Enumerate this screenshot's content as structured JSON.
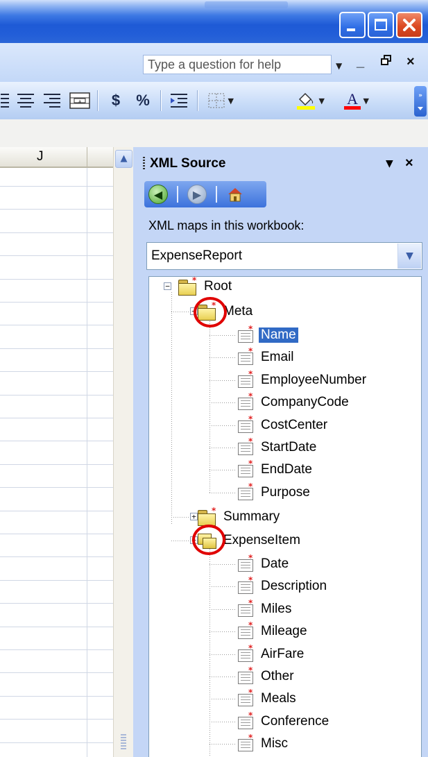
{
  "window": {
    "help_placeholder": "Type a question for help",
    "doc_controls": [
      "_",
      "❐",
      "×"
    ]
  },
  "toolbar": {
    "currency": "$",
    "percent": "%",
    "font_color_letter": "A"
  },
  "sheet": {
    "column_label": "J"
  },
  "pane": {
    "title": "XML Source",
    "maps_label": "XML maps in this workbook:",
    "selected_map": "ExpenseReport",
    "tree": {
      "root": "Root",
      "meta": "Meta",
      "meta_items": [
        "Name",
        "Email",
        "EmployeeNumber",
        "CompanyCode",
        "CostCenter",
        "StartDate",
        "EndDate",
        "Purpose"
      ],
      "summary": "Summary",
      "expense_item": "ExpenseItem",
      "expense_items": [
        "Date",
        "Description",
        "Miles",
        "Mileage",
        "AirFare",
        "Other",
        "Meals",
        "Conference",
        "Misc"
      ],
      "selected": "Name"
    }
  },
  "colors": {
    "title_blue": "#1e5ad6",
    "selection": "#316ac5",
    "highlight_circle": "#e00000"
  }
}
